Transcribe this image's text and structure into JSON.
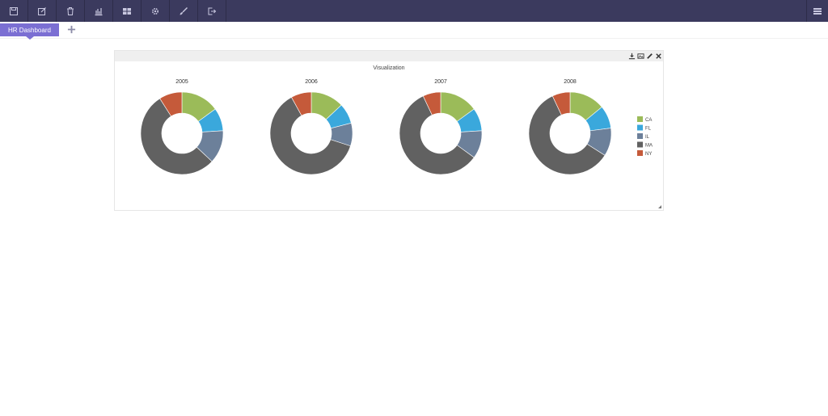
{
  "toolbar": {
    "icons": [
      "save-icon",
      "edit-icon",
      "delete-icon",
      "bar-chart-icon",
      "layout-icon",
      "gear-icon",
      "brush-icon",
      "export-icon"
    ],
    "right_icon": "menu-icon",
    "bg": "#3b3a5e"
  },
  "tabs": {
    "active_label": "HR Dashboard",
    "add_icon": "plus-icon",
    "active_color": "#7b6fd3"
  },
  "panel": {
    "title": "Visualization",
    "header_icons": [
      "download-icon",
      "image-icon",
      "pencil-icon",
      "close-icon"
    ]
  },
  "chart_data": {
    "type": "pie",
    "donut": true,
    "categories": [
      "CA",
      "FL",
      "IL",
      "MA",
      "NY"
    ],
    "colors": [
      "#9bbb59",
      "#3aa8dc",
      "#6c809a",
      "#616161",
      "#c55a3a"
    ],
    "legend_position": "right",
    "charts": [
      {
        "title": "2005",
        "values": [
          15,
          9,
          13,
          54,
          9
        ]
      },
      {
        "title": "2006",
        "values": [
          13,
          8,
          9,
          62,
          8
        ]
      },
      {
        "title": "2007",
        "values": [
          15,
          9,
          11,
          58,
          7
        ]
      },
      {
        "title": "2008",
        "values": [
          14,
          9,
          11,
          59,
          7
        ]
      }
    ]
  }
}
